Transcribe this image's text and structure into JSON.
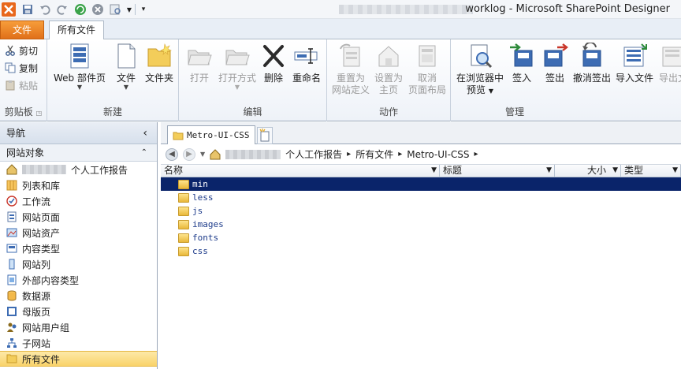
{
  "window": {
    "title": "worklog  -  Microsoft SharePoint Designer"
  },
  "tabs": {
    "file": "文件",
    "all_files": "所有文件"
  },
  "ribbon": {
    "clipboard": {
      "label": "剪贴板",
      "cut": "剪切",
      "copy": "复制",
      "paste": "粘贴"
    },
    "new": {
      "label": "新建",
      "web_part_page": "Web 部件页",
      "file": "文件",
      "folder": "文件夹"
    },
    "edit": {
      "label": "编辑",
      "open": "打开",
      "open_with": "打开方式",
      "delete": "删除",
      "rename": "重命名"
    },
    "actions": {
      "label": "动作",
      "reset_line1": "重置为",
      "reset_line2": "网站定义",
      "set_home_line1": "设置为",
      "set_home_line2": "主页",
      "detach_line1": "取消",
      "detach_line2": "页面布局"
    },
    "manage": {
      "label": "管理",
      "preview_line1": "在浏览器中",
      "preview_line2": "预览",
      "check_in": "签入",
      "check_out": "签出",
      "undo_checkout": "撤消签出",
      "import": "导入文件",
      "export": "导出文"
    }
  },
  "nav": {
    "header": "导航",
    "section": "网站对象",
    "items": [
      {
        "label": "个人工作报告",
        "icon": "home-icon"
      },
      {
        "label": "列表和库",
        "icon": "list-icon"
      },
      {
        "label": "工作流",
        "icon": "workflow-icon"
      },
      {
        "label": "网站页面",
        "icon": "page-icon"
      },
      {
        "label": "网站资产",
        "icon": "asset-icon"
      },
      {
        "label": "内容类型",
        "icon": "content-type-icon"
      },
      {
        "label": "网站列",
        "icon": "column-icon"
      },
      {
        "label": "外部内容类型",
        "icon": "external-icon"
      },
      {
        "label": "数据源",
        "icon": "database-icon"
      },
      {
        "label": "母版页",
        "icon": "master-page-icon"
      },
      {
        "label": "网站用户组",
        "icon": "users-icon"
      },
      {
        "label": "子网站",
        "icon": "subsite-icon"
      },
      {
        "label": "所有文件",
        "icon": "folder-icon"
      }
    ]
  },
  "doc": {
    "tab_label": "Metro-UI-CSS",
    "breadcrumb": {
      "site": "个人工作报告",
      "all_files": "所有文件",
      "folder": "Metro-UI-CSS",
      "sep": "▸"
    },
    "columns": {
      "name": "名称",
      "title": "标题",
      "size": "大小",
      "type": "类型"
    },
    "rows": [
      "min",
      "less",
      "js",
      "images",
      "fonts",
      "css"
    ]
  },
  "colors": {
    "file_tab": "#e0701a",
    "selection": "#0a246a",
    "nav_selected": "#f9d36a"
  }
}
